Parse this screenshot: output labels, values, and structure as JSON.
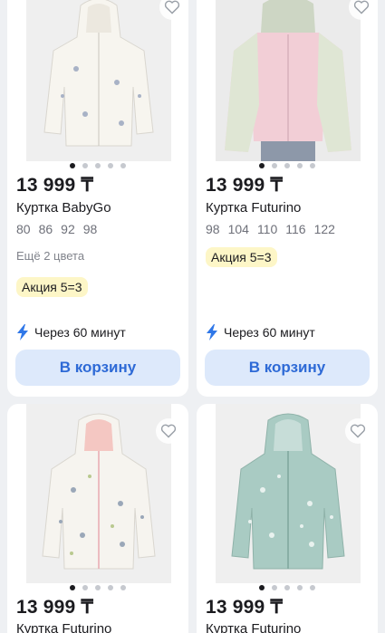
{
  "colors": {
    "accent": "#2e6ad6",
    "button_bg": "#dde9fb",
    "promo_bg": "#fdf6c7",
    "page_bg": "#eef0f3",
    "bolt": "#2f77e8"
  },
  "products": [
    {
      "price": "13 999 ₸",
      "name": "Куртка BabyGo",
      "sizes": [
        "80",
        "86",
        "92",
        "98"
      ],
      "more_colors": "Ещё 2 цвета",
      "promo": "Акция 5=3",
      "delivery": "Через 60 минут",
      "cart_label": "В корзину",
      "image_count": 5,
      "active_image": 1
    },
    {
      "price": "13 999 ₸",
      "name": "Куртка Futurino",
      "sizes": [
        "98",
        "104",
        "110",
        "116",
        "122"
      ],
      "promo": "Акция 5=3",
      "delivery": "Через 60 минут",
      "cart_label": "В корзину",
      "image_count": 5,
      "active_image": 1
    },
    {
      "price": "13 999 ₸",
      "name": "Куртка Futurino",
      "image_count": 5,
      "active_image": 1
    },
    {
      "price": "13 999 ₸",
      "name": "Куртка Futurino",
      "image_count": 5,
      "active_image": 1
    }
  ]
}
